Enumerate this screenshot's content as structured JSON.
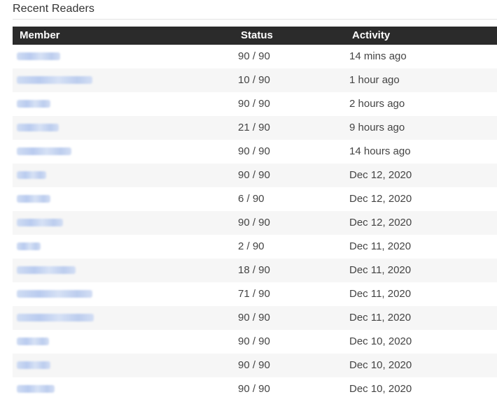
{
  "section": {
    "title": "Recent Readers"
  },
  "table": {
    "headers": {
      "member": "Member",
      "status": "Status",
      "activity": "Activity"
    },
    "rows": [
      {
        "status": "90 / 90",
        "activity": "14 mins ago"
      },
      {
        "status": "10 / 90",
        "activity": "1 hour ago"
      },
      {
        "status": "90 / 90",
        "activity": "2 hours ago"
      },
      {
        "status": "21 / 90",
        "activity": "9 hours ago"
      },
      {
        "status": "90 / 90",
        "activity": "14 hours ago"
      },
      {
        "status": "90 / 90",
        "activity": "Dec 12, 2020"
      },
      {
        "status": "6 / 90",
        "activity": "Dec 12, 2020"
      },
      {
        "status": "90 / 90",
        "activity": "Dec 12, 2020"
      },
      {
        "status": "2 / 90",
        "activity": "Dec 11, 2020"
      },
      {
        "status": "18 / 90",
        "activity": "Dec 11, 2020"
      },
      {
        "status": "71 / 90",
        "activity": "Dec 11, 2020"
      },
      {
        "status": "90 / 90",
        "activity": "Dec 11, 2020"
      },
      {
        "status": "90 / 90",
        "activity": "Dec 10, 2020"
      },
      {
        "status": "90 / 90",
        "activity": "Dec 10, 2020"
      },
      {
        "status": "90 / 90",
        "activity": "Dec 10, 2020"
      }
    ]
  },
  "colors": {
    "header_bg": "#2b2b2b",
    "header_text": "#ffffff",
    "alt_row_bg": "#f6f6f6",
    "member_link": "#b9cbef"
  }
}
